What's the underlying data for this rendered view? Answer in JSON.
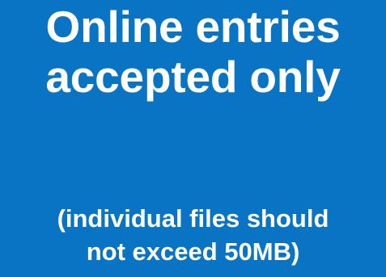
{
  "banner": {
    "background_color": "#0a74c4",
    "text_color": "#ffffff",
    "headline": {
      "line1": "Online entries",
      "line2": "accepted only"
    },
    "note": {
      "line1": "(individual files should",
      "line2": "not exceed 50MB)"
    }
  }
}
